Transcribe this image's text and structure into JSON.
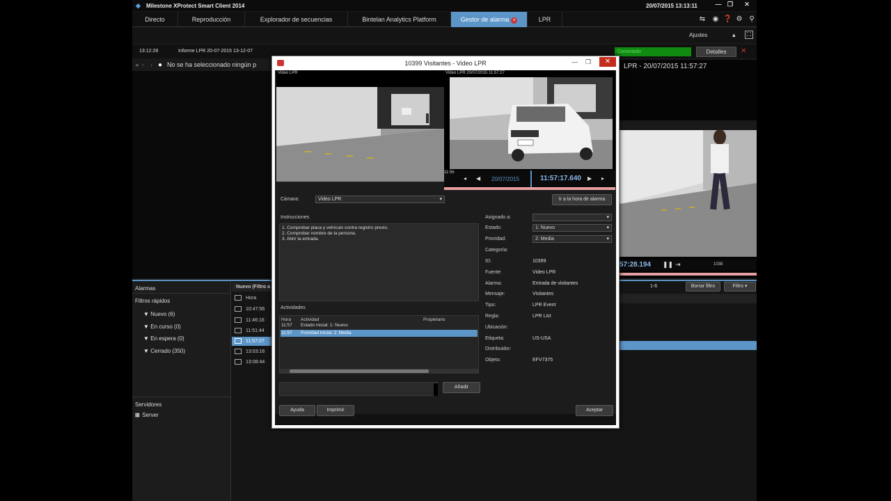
{
  "app": {
    "title": "Milestone XProtect Smart Client 2014",
    "datetime": "20/07/2015 13:13:11"
  },
  "tabs": [
    {
      "label": "Directo"
    },
    {
      "label": "Reproducción"
    },
    {
      "label": "Explorador de secuencias"
    },
    {
      "label": "Bintelan Analytics Platform"
    },
    {
      "label": "Gestor de alarma"
    },
    {
      "label": "LPR"
    }
  ],
  "toolbar": {
    "ajustes_label": "Ajustes"
  },
  "infobar": {
    "time": "13:12:28",
    "info": "Informe LPR 20-07-2015 13-12-07",
    "status": "Conectado",
    "details_label": "Detalles"
  },
  "nav": {
    "message": "No se ha seleccionado ningún p"
  },
  "right_view": {
    "label": "LPR - 20/07/2015 11:57:27",
    "time": "57:28.194",
    "tick": "1038"
  },
  "alarm_panel": {
    "alarms_title": "Alarmas",
    "list_header": "Nuevo (Filtro a",
    "quick_filters_title": "Filtros rápidos",
    "filters": [
      {
        "label": "Nuevo (6)"
      },
      {
        "label": "En curso (0)"
      },
      {
        "label": "En espera (0)"
      },
      {
        "label": "Cerrado (350)"
      }
    ],
    "servers_title": "Servidores",
    "server": "Server",
    "hora_header": "Hora",
    "rows": [
      "10:47:56",
      "11:46:16",
      "11:51:44",
      "11:57:27",
      "13:03:16",
      "13:08:44"
    ],
    "count": "1-6",
    "clear_filter_label": "Borrar filtro",
    "filters_label": "Filtro"
  },
  "dialog": {
    "title": "10399 Visitantes - Video LPR",
    "cam1_label": "Video LPR",
    "cam2_label": "Video LPR   20/07/2015 11:57:27",
    "playback": {
      "start": "11:56",
      "date": "20/07/2015",
      "time": "11:57:17.640"
    },
    "camera_label": "Cámara:",
    "camera_value": "Video LPR",
    "goto_alarm_label": "Ir a la hora de alarma",
    "instructions_title": "Instrucciones",
    "instructions": [
      "1. Comprobar placa y vehículo contra registro previo.",
      "2. Comprobar nombre de la persona.",
      "3. Abrir la entrada."
    ],
    "activities_title": "Actividades",
    "activity_headers": {
      "time": "Hora",
      "activity": "Actividad",
      "owner": "Propietario"
    },
    "activities": [
      {
        "time": "11:57",
        "activity": "Estado inicial: 1: Nuevo"
      },
      {
        "time": "11:57",
        "activity": "Prioridad inicial: 2: Media"
      }
    ],
    "add_label": "Añadir",
    "help_label": "Ayuda",
    "print_label": "Imprimir",
    "accept_label": "Aceptar",
    "fields": [
      {
        "label": "Asignado a:",
        "value": ""
      },
      {
        "label": "Estado:",
        "value": "1: Nuevo"
      },
      {
        "label": "Prioridad:",
        "value": "2: Media"
      },
      {
        "label": "Categoría:",
        "value": ""
      },
      {
        "label": "ID:",
        "value": "10399"
      },
      {
        "label": "Fuente:",
        "value": "Video LPR"
      },
      {
        "label": "Alarma:",
        "value": "Entrada de visitantes"
      },
      {
        "label": "Mensaje:",
        "value": "Visitantes"
      },
      {
        "label": "Tipo:",
        "value": "LPR Event"
      },
      {
        "label": "Regla:",
        "value": "LPR List"
      },
      {
        "label": "Ubicación:",
        "value": ""
      },
      {
        "label": "Etiqueta:",
        "value": "US-USA"
      },
      {
        "label": "Distribuidor:",
        "value": ""
      },
      {
        "label": "Objeto:",
        "value": "EFV7375"
      }
    ]
  },
  "colors": {
    "accent": "#5c95c8",
    "status_green": "#118a11",
    "close_red": "#c42b1c"
  },
  "icons": [
    "milestone-logo-icon",
    "minimize-icon",
    "restore-icon",
    "close-icon",
    "camera-view-icon",
    "filter-icon",
    "server-icon",
    "chevron-down-icon",
    "play-icon",
    "rewind-icon",
    "pause-icon"
  ]
}
